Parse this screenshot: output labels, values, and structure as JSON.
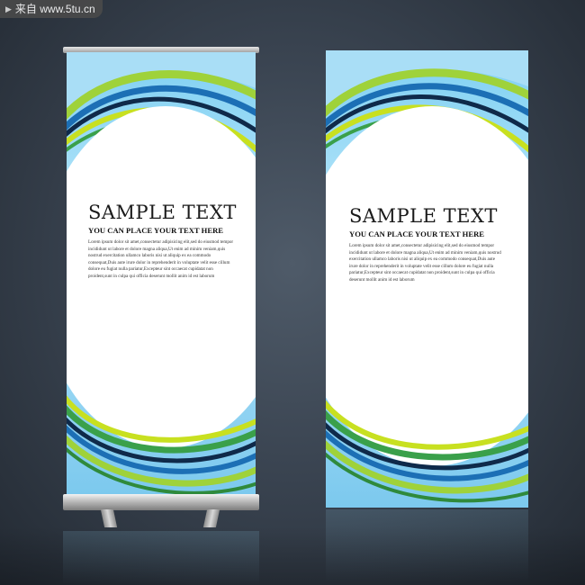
{
  "watermark": {
    "arrow_icon": "play-arrow-icon",
    "text": "来自 www.5tu.cn"
  },
  "colors": {
    "background": "#2f3742",
    "banner_sky": "#8fd5f4",
    "swoosh_green": "#8cc63f",
    "swoosh_lime": "#c8e020",
    "swoosh_blue": "#1c6fb5",
    "swoosh_navy": "#0f2a4a"
  },
  "banners": [
    {
      "title": "SAMPLE TEXT",
      "subtitle": "YOU CAN PLACE YOUR TEXT HERE",
      "body": "Lorem ipsum dolor sit amet,consectetur adipisicing elit,sed do eiusmod tempor incididunt ut labore et dolore magna aliqua,Ut enim ad minim veniam,quis nostrud exercitation ullamco laboris nisi ut aliquip ex ea commodo consequat,Duis aute irure dolor in reprehenderit in voluptate velit esse cillum dolore eu fugiat nulla pariatur,Excepteur sint occaecat cupidatat non proident,sunt in culpa qui officia deserunt mollit anim id est laborum"
    },
    {
      "title": "SAMPLE TEXT",
      "subtitle": "YOU CAN PLACE YOUR TEXT HERE",
      "body": "Lorem ipsum dolor sit amet,consectetur adipisicing elit,sed do eiusmod tempor incididunt ut labore et dolore magna aliqua,Ut enim ad minim veniam,quis nostrud exercitation ullamco laboris nisi ut aliquip ex ea commodo consequat,Duis aute irure dolor in reprehenderit in voluptate velit esse cillum dolore eu fugiat nulla pariatur,Excepteur sint occaecat cupidatat non proident,sunt in culpa qui officia deserunt mollit anim id est laborum"
    }
  ]
}
